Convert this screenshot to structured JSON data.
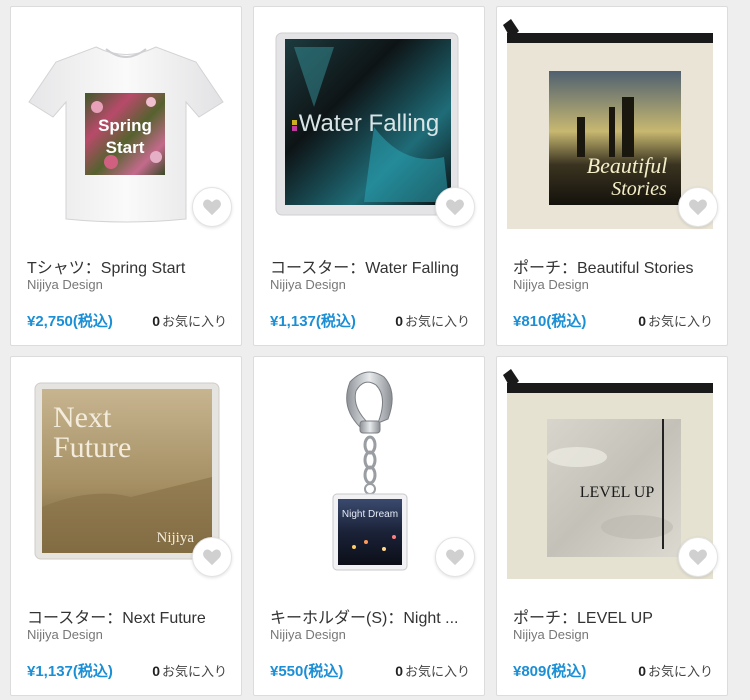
{
  "products": [
    {
      "title": "Tシャツ：Spring Start",
      "shop": "Nijiya Design",
      "price": "¥2,750(税込)",
      "fav_count": "0",
      "fav_label": "お気に入り",
      "print_text_1": "Spring",
      "print_text_2": "Start",
      "icon": "t-shirt"
    },
    {
      "title": "コースター：Water Falling",
      "shop": "Nijiya Design",
      "price": "¥1,137(税込)",
      "fav_count": "0",
      "fav_label": "お気に入り",
      "print_text_1": "Water Falling",
      "icon": "coaster"
    },
    {
      "title": "ポーチ：Beautiful Stories",
      "shop": "Nijiya Design",
      "price": "¥810(税込)",
      "fav_count": "0",
      "fav_label": "お気に入り",
      "print_text_1": "Beautiful",
      "print_text_2": "Stories",
      "icon": "pouch"
    },
    {
      "title": "コースター：Next Future",
      "shop": "Nijiya Design",
      "price": "¥1,137(税込)",
      "fav_count": "0",
      "fav_label": "お気に入り",
      "print_text_1": "Next",
      "print_text_2": "Future",
      "print_text_3": "Nijiya",
      "icon": "coaster"
    },
    {
      "title": "キーホルダー(S)：Night ...",
      "shop": "Nijiya Design",
      "price": "¥550(税込)",
      "fav_count": "0",
      "fav_label": "お気に入り",
      "print_text_1": "Night Dream",
      "icon": "keychain"
    },
    {
      "title": "ポーチ：LEVEL UP",
      "shop": "Nijiya Design",
      "price": "¥809(税込)",
      "fav_count": "0",
      "fav_label": "お気に入り",
      "print_text_1": "LEVEL UP",
      "icon": "pouch"
    }
  ],
  "colors": {
    "price": "#1a8fd6",
    "heart": "#d0d0d0"
  }
}
